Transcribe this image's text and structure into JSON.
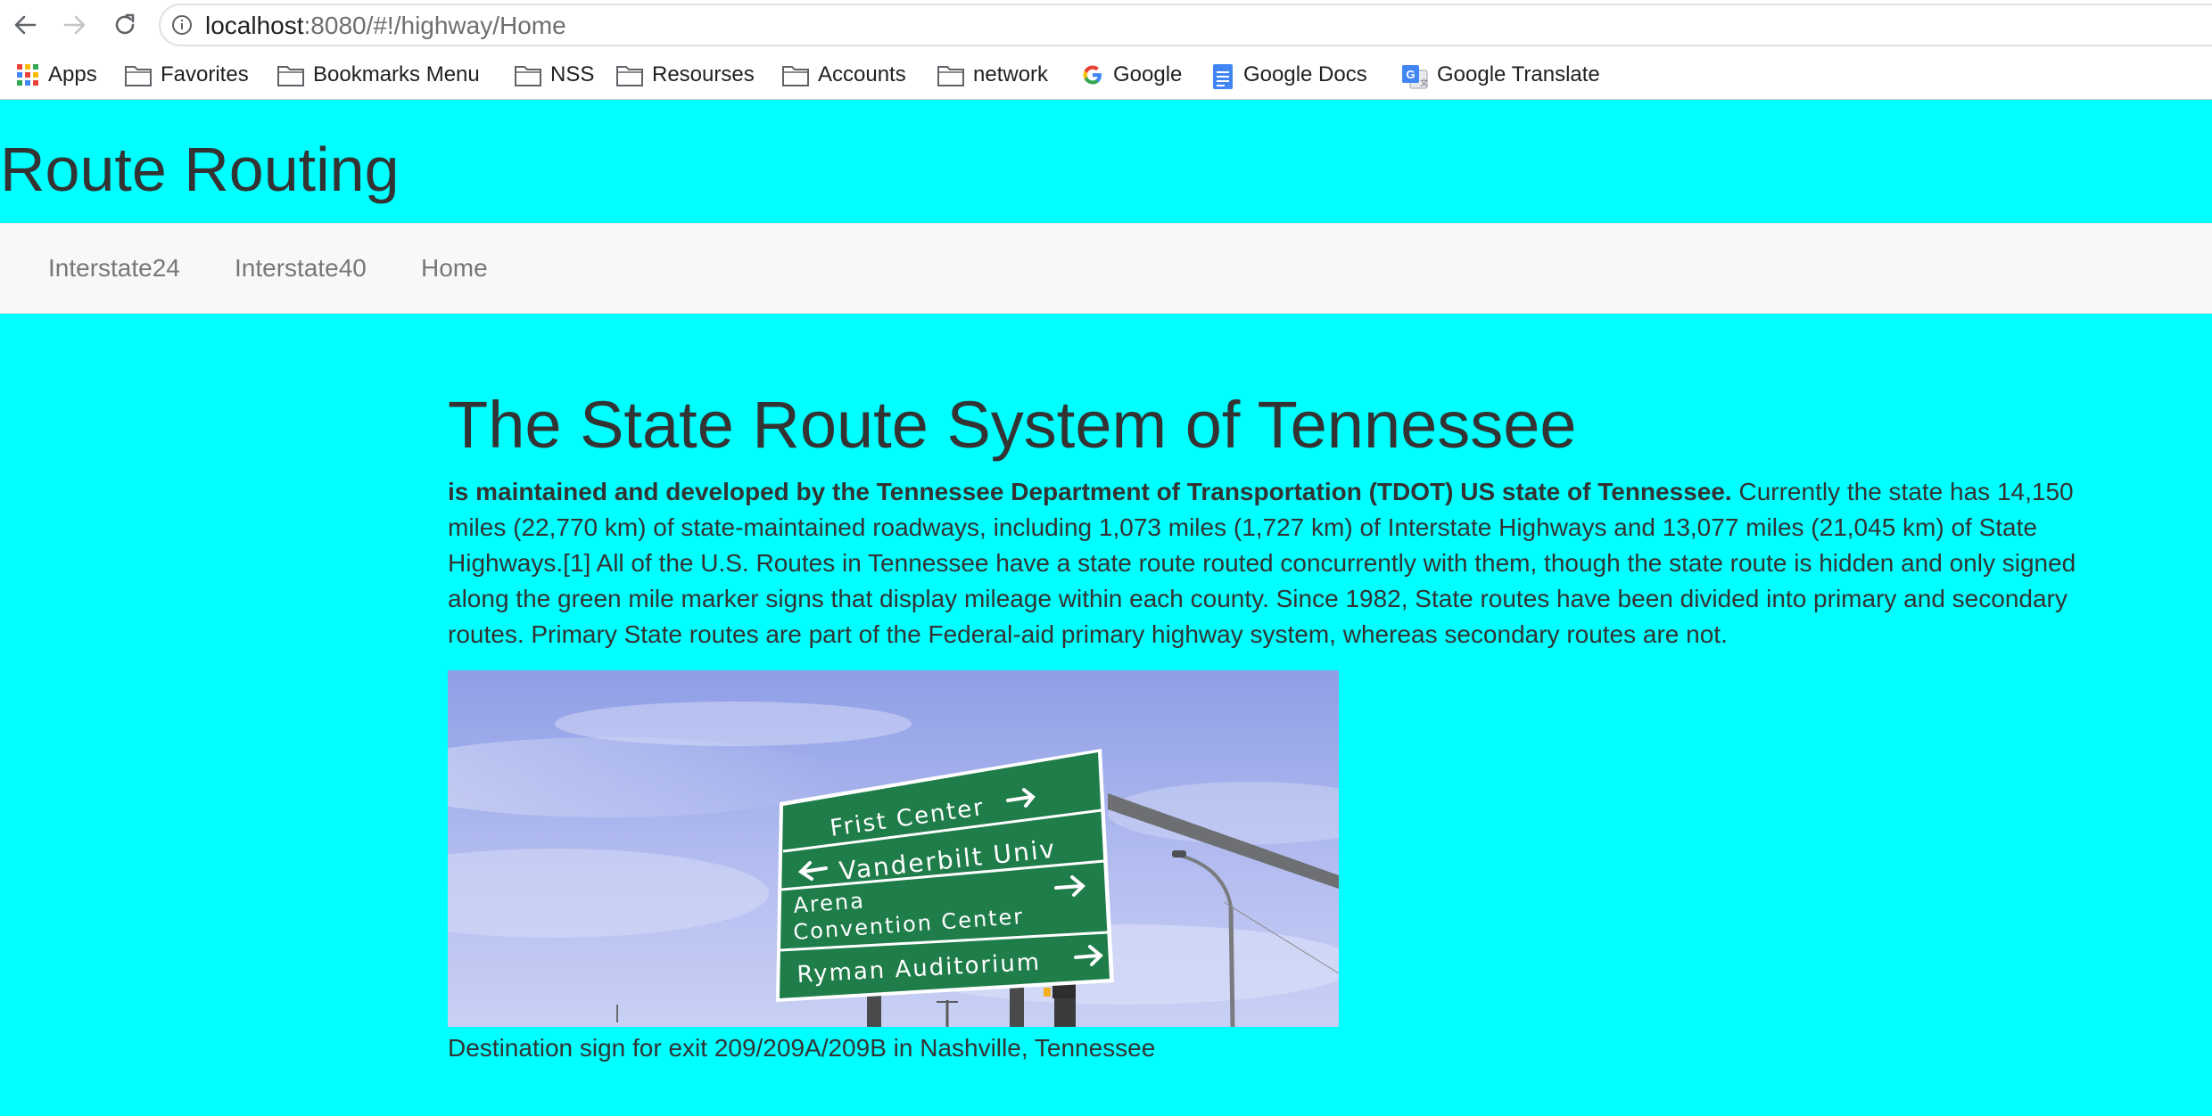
{
  "browser": {
    "url_host": "localhost",
    "url_rest": ":8080/#!/highway/Home",
    "bookmarks": [
      {
        "label": "Apps",
        "icon": "apps-grid-icon"
      },
      {
        "label": "Favorites",
        "icon": "folder-icon"
      },
      {
        "label": "Bookmarks Menu",
        "icon": "folder-icon"
      },
      {
        "label": "NSS",
        "icon": "folder-icon"
      },
      {
        "label": "Resourses",
        "icon": "folder-icon"
      },
      {
        "label": "Accounts",
        "icon": "folder-icon"
      },
      {
        "label": "network",
        "icon": "folder-icon"
      },
      {
        "label": "Google",
        "icon": "google-icon"
      },
      {
        "label": "Google Docs",
        "icon": "google-docs-icon"
      },
      {
        "label": "Google Translate",
        "icon": "google-translate-icon"
      }
    ]
  },
  "site": {
    "title": "Route Routing",
    "nav": [
      "Interstate24",
      "Interstate40",
      "Home"
    ]
  },
  "main": {
    "heading": "The State Route System of Tennessee",
    "intro_bold": "is maintained and developed by the Tennessee Department of Transportation (TDOT) US state of Tennessee.",
    "intro_text": " Currently the state has 14,150 miles (22,770 km) of state-maintained roadways, including 1,073 miles (1,727 km) of Interstate Highways and 13,077 miles (21,045 km) of State Highways.[1] All of the U.S. Routes in Tennessee have a state route routed concurrently with them, though the state route is hidden and only signed along the green mile marker signs that display mileage within each county. Since 1982, State routes have been divided into primary and secondary routes. Primary State routes are part of the Federal-aid primary highway system, whereas secondary routes are not.",
    "photo": {
      "sign_lines": [
        "Frist Center",
        "Vanderbilt Univ",
        "Arena",
        "Convention Center",
        "Ryman Auditorium"
      ]
    },
    "caption": "Destination sign for exit 209/209A/209B in Nashville, Tennessee"
  },
  "colors": {
    "page_background": "#00ffff",
    "nav_background": "#f8f8f8",
    "sign_green": "#1f7d4a"
  }
}
